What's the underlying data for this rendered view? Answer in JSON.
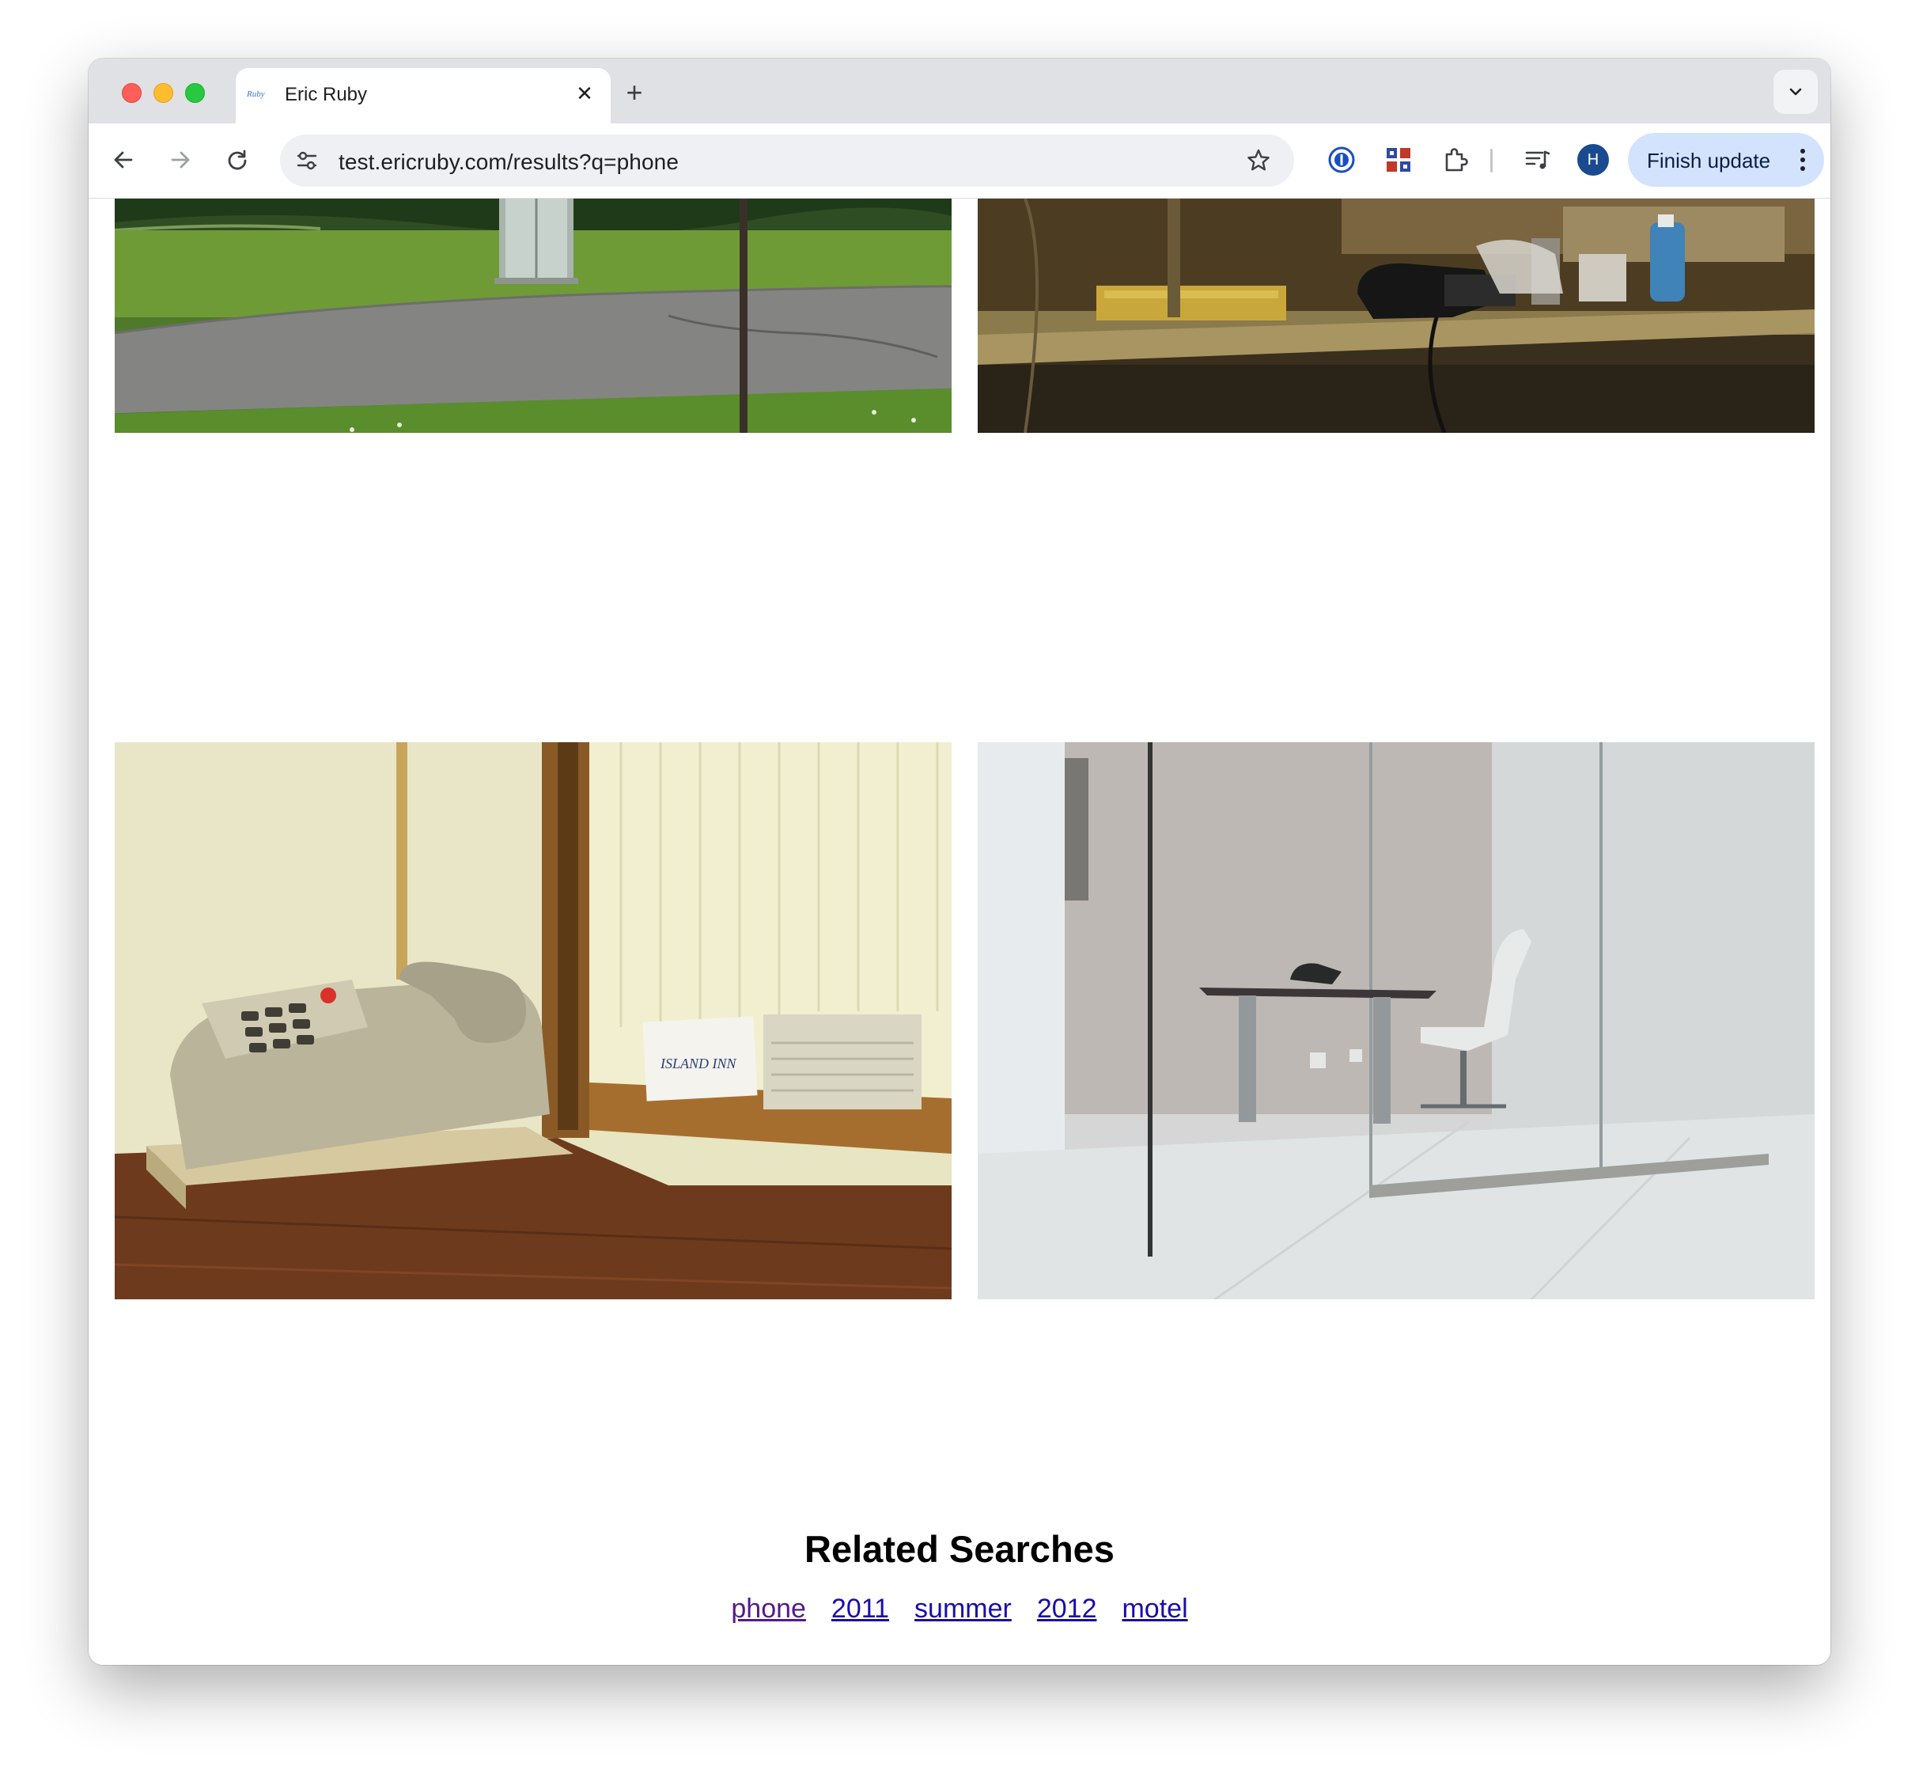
{
  "browser": {
    "tab": {
      "favicon_text": "Ruby",
      "title": "Eric Ruby"
    },
    "address_bar": {
      "url": "test.ericruby.com/results?q=phone"
    },
    "profile_initial": "H",
    "update_button_label": "Finish update"
  },
  "page": {
    "photos": [
      {
        "id": "phone-booth-lawn"
      },
      {
        "id": "desk-phone-shelf"
      },
      {
        "id": "motel-phone-mirror",
        "visible_text": "ISLAND INN"
      },
      {
        "id": "glass-office-phone"
      }
    ],
    "related_searches": {
      "heading": "Related Searches",
      "links": [
        "phone",
        "2011",
        "summer",
        "2012",
        "motel"
      ]
    }
  },
  "colors": {
    "tabstrip_bg": "#dfe1e5",
    "omnibox_bg": "#eef0f3",
    "update_button_bg": "#d3e3fd",
    "link_visited": "#551a8b",
    "link_unvisited": "#1a0dab"
  }
}
